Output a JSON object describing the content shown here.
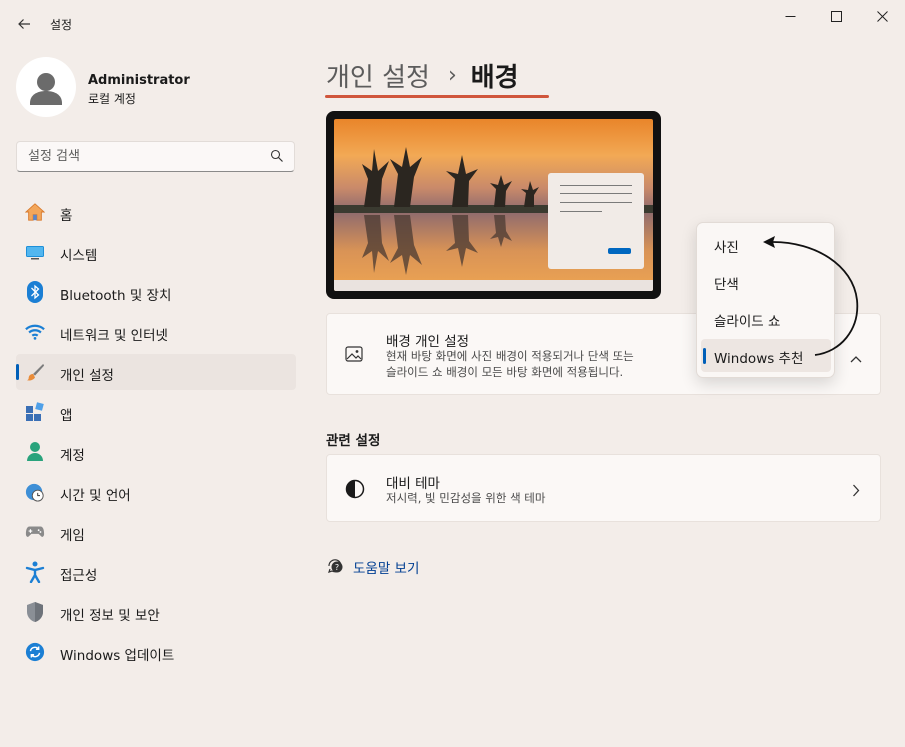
{
  "window": {
    "title": "설정"
  },
  "profile": {
    "name": "Administrator",
    "account_type": "로컬 계정"
  },
  "search": {
    "placeholder": "설정 검색"
  },
  "nav": {
    "items": [
      {
        "label": "홈",
        "icon": "home-icon"
      },
      {
        "label": "시스템",
        "icon": "system-icon"
      },
      {
        "label": "Bluetooth 및 장치",
        "icon": "bluetooth-icon"
      },
      {
        "label": "네트워크 및 인터넷",
        "icon": "wifi-icon"
      },
      {
        "label": "개인 설정",
        "icon": "brush-icon",
        "selected": true
      },
      {
        "label": "앱",
        "icon": "apps-icon"
      },
      {
        "label": "계정",
        "icon": "account-icon"
      },
      {
        "label": "시간 및 언어",
        "icon": "clock-globe-icon"
      },
      {
        "label": "게임",
        "icon": "gamepad-icon"
      },
      {
        "label": "접근성",
        "icon": "accessibility-icon"
      },
      {
        "label": "개인 정보 및 보안",
        "icon": "shield-icon"
      },
      {
        "label": "Windows 업데이트",
        "icon": "update-icon"
      }
    ]
  },
  "breadcrumb": {
    "parent": "개인 설정",
    "separator": "›",
    "current": "배경"
  },
  "background_card": {
    "title": "배경 개인 설정",
    "description_line1": "현재 바탕 화면에 사진 배경이 적용되거나 단색 또는",
    "description_line2": "슬라이드 쇼 배경이 모든 바탕 화면에 적용됩니다.",
    "icon": "image-icon"
  },
  "dropdown": {
    "options": [
      "사진",
      "단색",
      "슬라이드 쇼",
      "Windows 추천"
    ],
    "selected": "Windows 추천"
  },
  "related": {
    "heading": "관련 설정",
    "contrast_title": "대비 테마",
    "contrast_desc": "저시력, 빛 민감성을 위한 색 테마"
  },
  "help": {
    "label": "도움말 보기"
  },
  "colors": {
    "accent": "#005fb8",
    "breadcrumb_underline": "#d0563c",
    "background": "#f3ede9"
  }
}
